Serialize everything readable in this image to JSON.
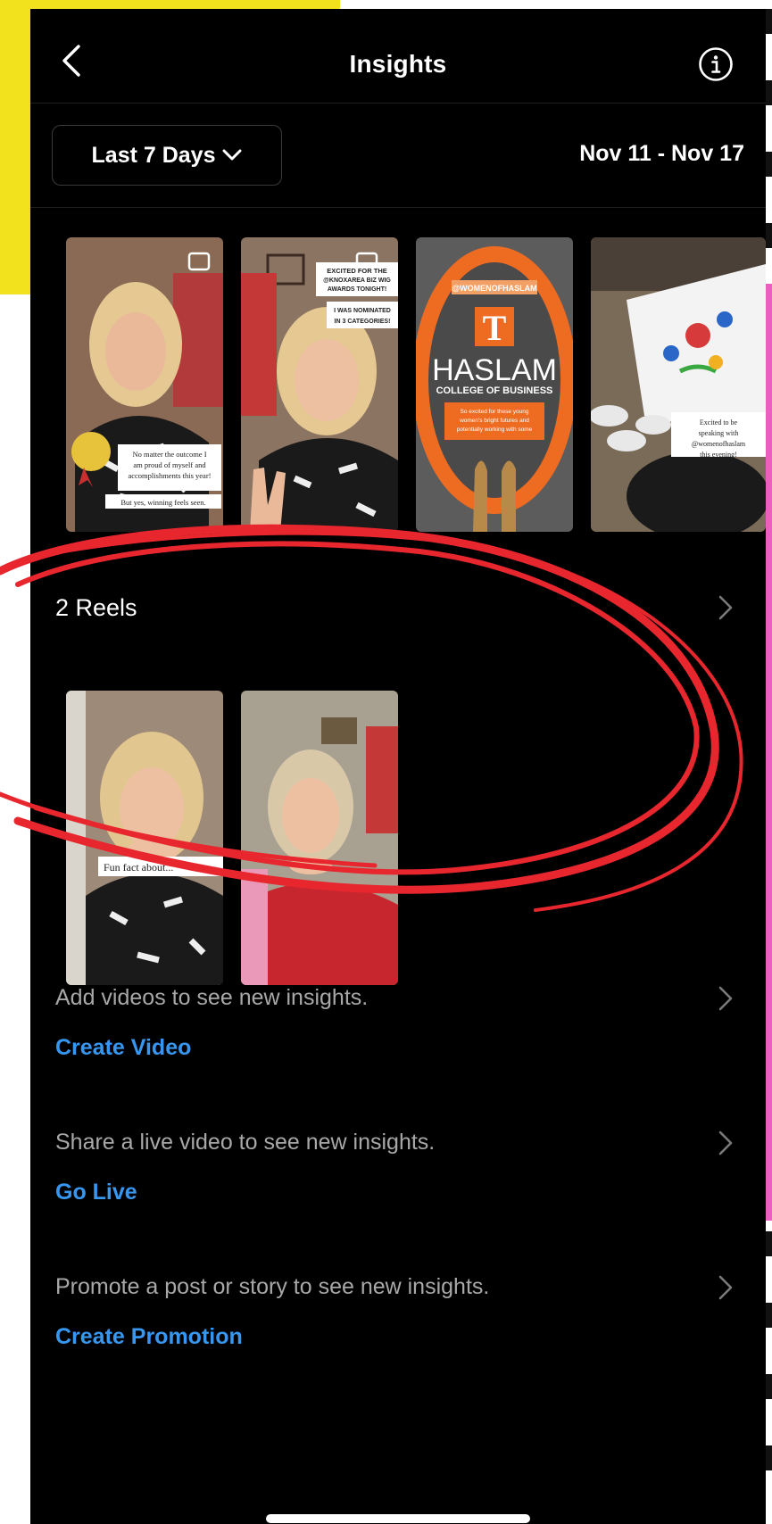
{
  "header": {
    "title": "Insights"
  },
  "filter": {
    "range_label": "Last 7 Days",
    "date_range": "Nov 11 - Nov 17"
  },
  "stories": [
    {
      "caption_top": "",
      "caption_main": "No matter the outcome I am proud of myself and accomplishments this year!",
      "caption_sub": "But yes, winning feels seen."
    },
    {
      "caption_top": "EXCITED FOR THE @KNOXAREA BIZ WIG AWARDS TONIGHT!",
      "caption_main": "I WAS NOMINATED IN 3 CATEGORIES!",
      "caption_sub": ""
    },
    {
      "caption_top": "@WOMENOFHASLAM",
      "logo_letter": "T",
      "caption_main": "HASLAM",
      "caption_sub": "COLLEGE OF BUSINESS",
      "note": "So excited for these young women's bright futures and potentially working with some of them again in the summer!"
    },
    {
      "caption_top": "",
      "caption_main": "Excited to be speaking with @womenofhaslam this evening!",
      "caption_sub": ""
    }
  ],
  "reels_section": {
    "label": "2 Reels"
  },
  "reels": [
    {
      "caption": "Fun fact about..."
    },
    {
      "caption": ""
    }
  ],
  "ctas": [
    {
      "text": "Add videos to see new insights.",
      "link": "Create Video"
    },
    {
      "text": "Share a live video to see new insights.",
      "link": "Go Live"
    },
    {
      "text": "Promote a post or story to see new insights.",
      "link": "Create Promotion"
    }
  ],
  "colors": {
    "accent": "#3797f0",
    "annotation": "#e8262e",
    "background": "#000000",
    "yellow": "#f2e21e",
    "pink": "#ea5fc2"
  },
  "icons": {
    "back": "chevron-left-icon",
    "info": "info-icon",
    "dropdown": "chevron-down-icon",
    "row": "chevron-right-icon"
  }
}
